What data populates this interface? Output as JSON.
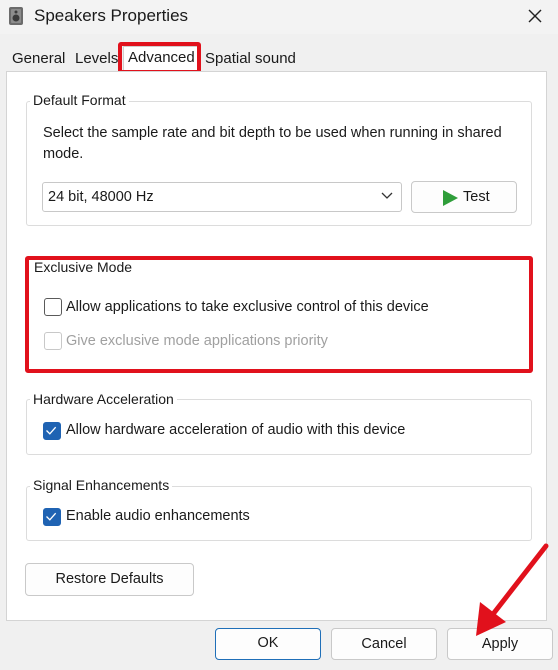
{
  "window": {
    "title": "Speakers Properties",
    "icon": "speaker-icon",
    "close_icon": "close-icon"
  },
  "tabs": [
    {
      "label": "General",
      "active": false
    },
    {
      "label": "Levels",
      "active": false
    },
    {
      "label": "Advanced",
      "active": true
    },
    {
      "label": "Spatial sound",
      "active": false
    }
  ],
  "default_format": {
    "label": "Default Format",
    "description": "Select the sample rate and bit depth to be used when running in shared mode.",
    "selected_value": "24 bit, 48000 Hz",
    "test_label": "Test",
    "test_icon": "play-icon"
  },
  "exclusive_mode": {
    "label": "Exclusive Mode",
    "allow_label": "Allow applications to take exclusive control of this device",
    "allow_checked": false,
    "priority_label": "Give exclusive mode applications priority",
    "priority_checked": false,
    "priority_disabled": true
  },
  "hardware_acceleration": {
    "label": "Hardware Acceleration",
    "allow_label": "Allow hardware acceleration of audio with this device",
    "allow_checked": true
  },
  "signal_enhancements": {
    "label": "Signal Enhancements",
    "enable_label": "Enable audio enhancements",
    "enable_checked": true
  },
  "restore_defaults_label": "Restore Defaults",
  "footer": {
    "ok_label": "OK",
    "cancel_label": "Cancel",
    "apply_label": "Apply"
  },
  "annotation": {
    "highlight_color": "#e1111c",
    "accent_color": "#1f63b3"
  }
}
